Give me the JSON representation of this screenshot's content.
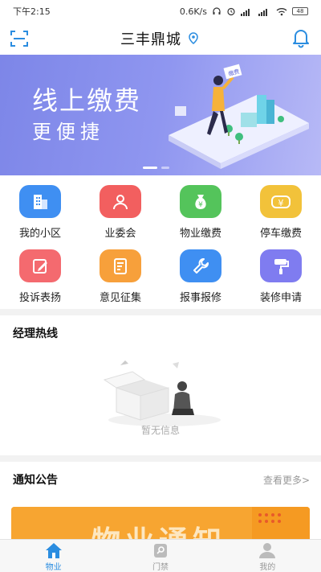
{
  "status_bar": {
    "time": "下午2:15",
    "speed": "0.6K/s",
    "battery": "48"
  },
  "header": {
    "title": "三丰鼎城"
  },
  "banner": {
    "line1": "线上缴费",
    "line2": "更便捷",
    "sign_text": "缴费"
  },
  "menu": {
    "items": [
      {
        "label": "我的小区",
        "icon": "building-icon",
        "color": "#3f8ff2"
      },
      {
        "label": "业委会",
        "icon": "people-icon",
        "color": "#f25f5f"
      },
      {
        "label": "物业缴费",
        "icon": "money-bag-icon",
        "color": "#54c45b"
      },
      {
        "label": "停车缴费",
        "icon": "car-yen-icon",
        "color": "#f2c23a"
      },
      {
        "label": "投诉表扬",
        "icon": "edit-icon",
        "color": "#f46a6f"
      },
      {
        "label": "意见征集",
        "icon": "form-icon",
        "color": "#f7a03b"
      },
      {
        "label": "报事报修",
        "icon": "wrench-icon",
        "color": "#3f8ff2"
      },
      {
        "label": "装修申请",
        "icon": "paint-roller-icon",
        "color": "#7f7cf0"
      }
    ]
  },
  "hotline": {
    "title": "经理热线",
    "empty_text": "暂无信息"
  },
  "notice": {
    "title": "通知公告",
    "more": "查看更多>",
    "banner_text": "物业通知"
  },
  "tabbar": {
    "tabs": [
      {
        "label": "物业",
        "icon": "home-icon",
        "active": true
      },
      {
        "label": "门禁",
        "icon": "key-icon",
        "active": false
      },
      {
        "label": "我的",
        "icon": "user-icon",
        "active": false
      }
    ]
  },
  "colors": {
    "accent": "#2b8de0",
    "banner": "#7d86e8"
  }
}
